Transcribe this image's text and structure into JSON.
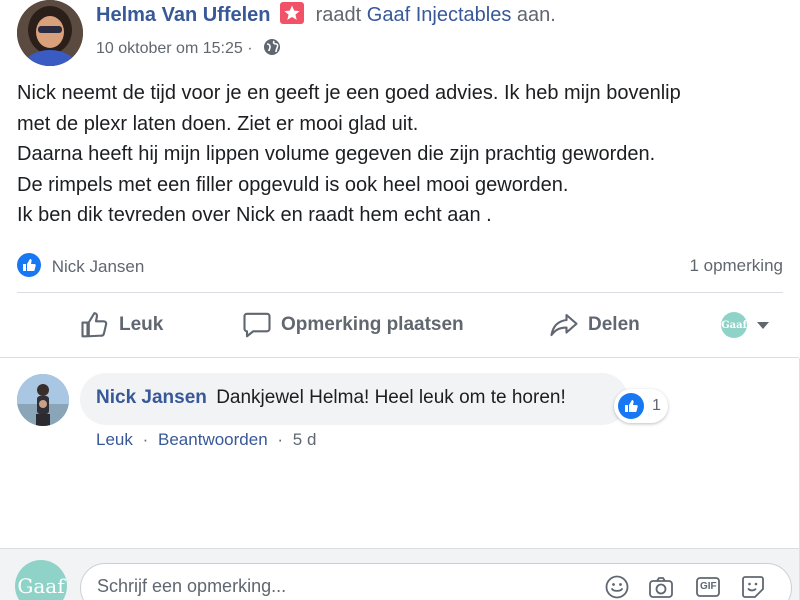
{
  "post": {
    "author": "Helma Van Uffelen",
    "verb": "raadt",
    "page": "Gaaf Injectables",
    "suffix": "aan.",
    "timestamp": "10 oktober om 15:25",
    "separator": "·",
    "privacy_icon": "globe-icon",
    "badge_icon": "star-icon",
    "text_lines": [
      "Nick neemt de tijd voor je en geeft je een goed advies. Ik heb mijn bovenlip",
      "met de plexr laten doen. Ziet er mooi glad uit.",
      "Daarna heeft hij mijn lippen volume gegeven die zijn prachtig geworden.",
      "De rimpels met een filler opgevuld is ook heel mooi geworden.",
      "Ik ben dik tevreden over Nick en raadt hem echt aan ."
    ],
    "reactions_by": "Nick Jansen",
    "comment_count": "1 opmerking"
  },
  "actions": {
    "like": "Leuk",
    "comment": "Opmerking plaatsen",
    "share": "Delen",
    "profile_logo": "Gaaf"
  },
  "comment": {
    "author": "Nick Jansen",
    "text": "Dankjewel Helma! Heel leuk om te horen!",
    "reaction_count": "1",
    "like_label": "Leuk",
    "reply_label": "Beantwoorden",
    "dot": "·",
    "age": "5 d"
  },
  "composer": {
    "avatar_text": "Gaaf",
    "placeholder": "Schrijf een opmerking...",
    "icons": [
      "emoji-icon",
      "camera-icon",
      "gif-icon",
      "sticker-icon"
    ],
    "gif_label": "GIF"
  },
  "colors": {
    "link": "#385898",
    "secondary": "#606770",
    "like_blue": "#1877f2",
    "badge": "#f25268",
    "gaaf_teal": "#8fd3c8",
    "bubble": "#f2f3f5"
  }
}
